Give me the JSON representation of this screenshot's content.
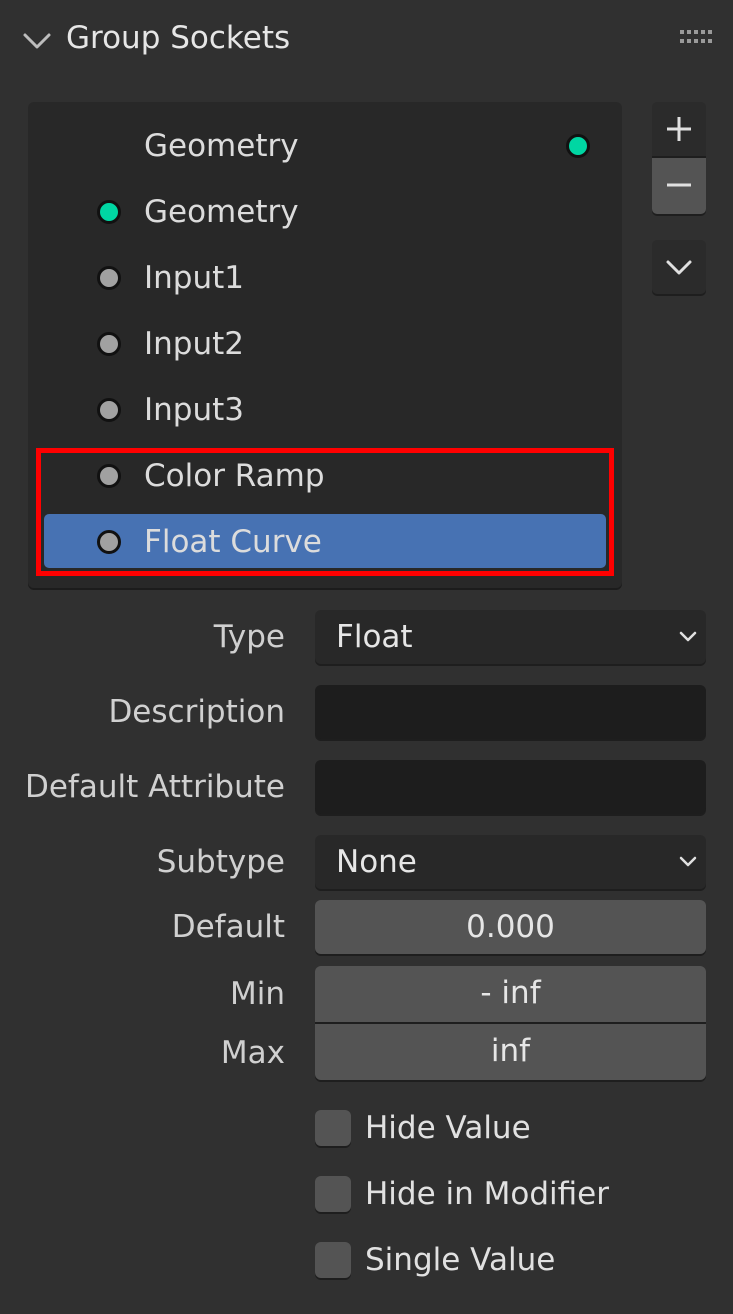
{
  "panel": {
    "title": "Group Sockets",
    "collapse_icon": "chevron-down-icon",
    "drag_icon": "drag-handle-icon"
  },
  "sockets": [
    {
      "label": "Geometry",
      "kind": "output",
      "color": "#00d6a3"
    },
    {
      "label": "Geometry",
      "kind": "input",
      "color": "#00d6a3"
    },
    {
      "label": "Input1",
      "kind": "input",
      "color": "#a1a1a1"
    },
    {
      "label": "Input2",
      "kind": "input",
      "color": "#a1a1a1"
    },
    {
      "label": "Input3",
      "kind": "input",
      "color": "#a1a1a1"
    },
    {
      "label": "Color Ramp",
      "kind": "input",
      "color": "#a1a1a1"
    },
    {
      "label": "Float Curve",
      "kind": "input",
      "color": "#a1a1a1",
      "selected": true
    }
  ],
  "side_buttons": {
    "add_icon": "plus-icon",
    "remove_icon": "minus-icon",
    "menu_icon": "chevron-down-icon"
  },
  "properties": {
    "type": {
      "label": "Type",
      "value": "Float"
    },
    "description": {
      "label": "Description",
      "value": ""
    },
    "default_attribute": {
      "label": "Default Attribute",
      "value": ""
    },
    "subtype": {
      "label": "Subtype",
      "value": "None"
    },
    "default": {
      "label": "Default",
      "value": "0.000"
    },
    "min": {
      "label": "Min",
      "value": "- inf"
    },
    "max": {
      "label": "Max",
      "value": "inf"
    }
  },
  "checkboxes": [
    {
      "label": "Hide Value",
      "checked": false
    },
    {
      "label": "Hide in Modifier",
      "checked": false
    },
    {
      "label": "Single Value",
      "checked": false
    }
  ],
  "colors": {
    "selection": "#4772b3",
    "highlight_box": "#ff0000",
    "geometry_socket": "#00d6a3"
  }
}
